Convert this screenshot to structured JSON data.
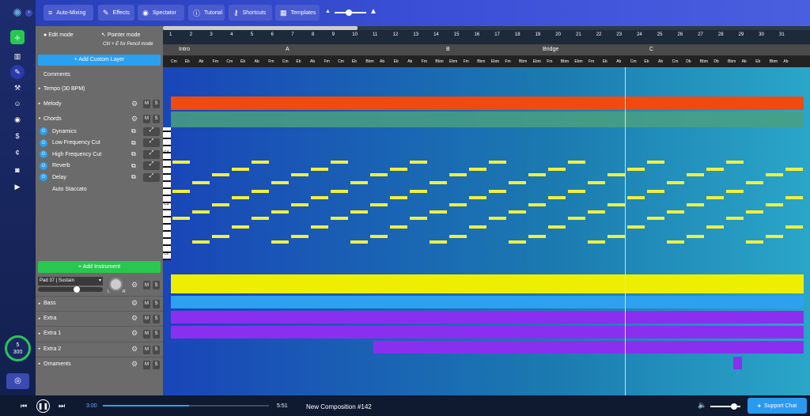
{
  "toolbar": {
    "buttons": [
      {
        "label": "Auto-Mixing",
        "icon": "sliders-icon"
      },
      {
        "label": "Effects",
        "icon": "wand-icon"
      },
      {
        "label": "Spectator",
        "icon": "eye-icon"
      },
      {
        "label": "Tutorial",
        "icon": "info-icon"
      },
      {
        "label": "Shortcuts",
        "icon": "key-icon"
      },
      {
        "label": "Templates",
        "icon": "grid-icon"
      }
    ],
    "zoom_fraction": 0.45
  },
  "mode": {
    "edit": "Edit mode",
    "pointer": "Pointer mode",
    "pencil_hint": "Ctrl + E for Pencil mode"
  },
  "panel": {
    "add_layer": "+ Add Custom Layer",
    "comments": "Comments",
    "tempo": "Tempo (30 BPM)",
    "melody": "Melody",
    "chords": "Chords",
    "effects": [
      "Dynamics",
      "Low Frequency Cut",
      "High Frequency Cut",
      "Reverb",
      "Delay",
      "Auto Staccato"
    ],
    "add_instrument": "+ Add Instrument",
    "instrument": "Pad 37 | Sustain",
    "pan_l": "L",
    "pan_r": "R",
    "tracks": [
      "Bass",
      "Extra",
      "Extra 1",
      "Extra 2",
      "Ornaments"
    ],
    "m": "M",
    "s": "S"
  },
  "sidebar": {
    "tempo_top": "5",
    "tempo_bottom": "300"
  },
  "ruler": {
    "bars": [
      "1",
      "2",
      "3",
      "4",
      "5",
      "6",
      "7",
      "8",
      "9",
      "10",
      "11",
      "12",
      "13",
      "14",
      "15",
      "16",
      "17",
      "18",
      "19",
      "20",
      "21",
      "22",
      "23",
      "24",
      "25",
      "26",
      "27",
      "28",
      "29",
      "30",
      "31"
    ],
    "sections": [
      "Intro",
      "A",
      "B",
      "Bridge",
      "C"
    ],
    "chords": [
      "Cm",
      "Eb",
      "Ab",
      "Fm",
      "Cm",
      "Eb",
      "Ab",
      "Fm",
      "Cm",
      "Eb",
      "Ab",
      "Fm",
      "Cm",
      "Eb",
      "Bbm",
      "Ab",
      "Eb",
      "Ab",
      "Fm",
      "Bbm",
      "Ebm",
      "Fm",
      "Bbm",
      "Ebm",
      "Fm",
      "Bbm",
      "Ebm",
      "Fm",
      "Bbm",
      "Ebm",
      "Fm",
      "Eb",
      "Ab",
      "Cm",
      "Eb",
      "Ab",
      "Cm",
      "Db",
      "Bbm",
      "Db",
      "Bbm",
      "Ab",
      "Eb",
      "Bbm",
      "Ab"
    ]
  },
  "piano": {
    "labels": [
      "C4",
      "C3",
      "C2"
    ]
  },
  "player": {
    "current": "3:00",
    "total": "5:51",
    "title": "New Composition #142",
    "progress": 0.52,
    "volume": 0.8,
    "support": "Support Chat"
  },
  "colors": {
    "melody": "#f04a10",
    "chords": "#4aa080",
    "notes": "#f0ef40",
    "pad": "#eeee00",
    "bass": "#2ea0f0",
    "extra": "#8a2ff0"
  }
}
